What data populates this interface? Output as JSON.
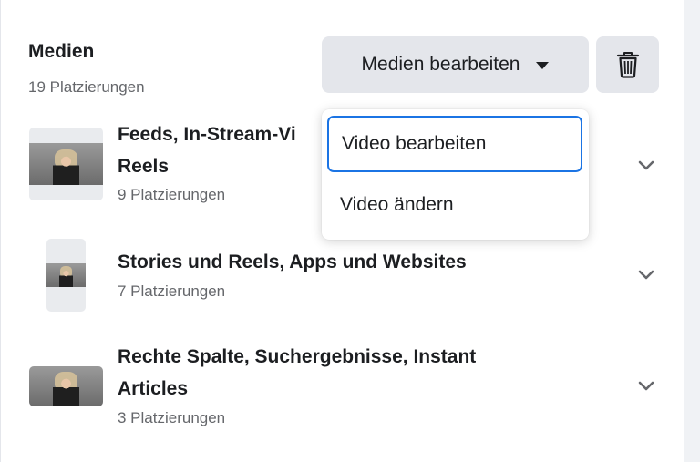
{
  "section": {
    "title": "Medien",
    "subtitle": "19 Platzierungen"
  },
  "toolbar": {
    "edit_label": "Medien bearbeiten",
    "edit_icon": "caret-down-icon",
    "delete_icon": "trash-icon"
  },
  "placements": [
    {
      "title": "Feeds, In-Stream-Vi",
      "title2": "Reels",
      "count": "9 Platzierungen"
    },
    {
      "title": "Stories und Reels, Apps und Websites",
      "count": "7 Platzierungen"
    },
    {
      "title": "Rechte Spalte, Suchergebnisse, Instant",
      "title2": "Articles",
      "count": "3 Platzierungen"
    }
  ],
  "dropdown": {
    "items": [
      {
        "label": "Video bearbeiten",
        "focused": true
      },
      {
        "label": "Video ändern",
        "focused": false
      }
    ]
  },
  "colors": {
    "accent": "#1b74e4",
    "button_bg": "#e4e6eb",
    "secondary_text": "#65676b"
  }
}
